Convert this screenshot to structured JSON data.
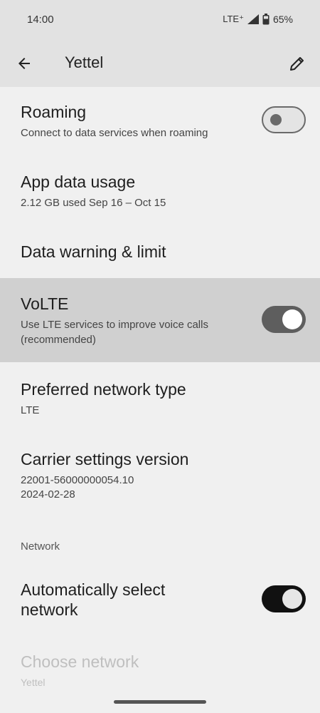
{
  "status_bar": {
    "time": "14:00",
    "network": "LTE⁺",
    "battery": "65%"
  },
  "app_bar": {
    "title": "Yettel"
  },
  "settings": {
    "roaming": {
      "title": "Roaming",
      "subtitle": "Connect to data services when roaming",
      "enabled": false
    },
    "app_data_usage": {
      "title": "App data usage",
      "subtitle": "2.12 GB used Sep 16 – Oct 15"
    },
    "data_warning": {
      "title": "Data warning & limit"
    },
    "volte": {
      "title": "VoLTE",
      "subtitle_line1": "Use LTE services to improve voice calls",
      "subtitle_line2": "(recommended)",
      "enabled": true
    },
    "preferred_network": {
      "title": "Preferred network type",
      "subtitle": "LTE"
    },
    "carrier_settings": {
      "title": "Carrier settings version",
      "subtitle_line1": "22001-56000000054.10",
      "subtitle_line2": "2024-02-28"
    }
  },
  "network_section": {
    "header": "Network",
    "auto_select": {
      "title_line1": "Automatically select",
      "title_line2": "network",
      "enabled": true
    },
    "choose_network": {
      "title": "Choose network",
      "subtitle": "Yettel",
      "disabled": true
    }
  }
}
